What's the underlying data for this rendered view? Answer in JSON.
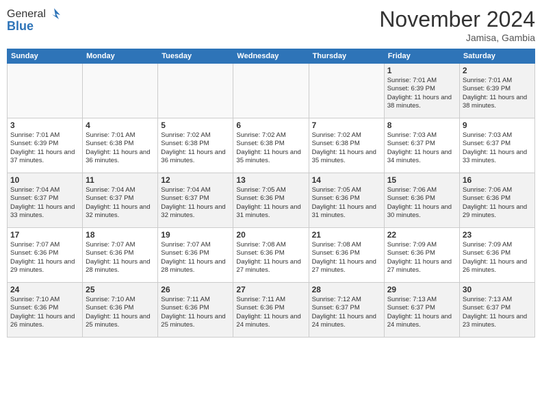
{
  "logo": {
    "general": "General",
    "blue": "Blue"
  },
  "header": {
    "month": "November 2024",
    "location": "Jamisa, Gambia"
  },
  "weekdays": [
    "Sunday",
    "Monday",
    "Tuesday",
    "Wednesday",
    "Thursday",
    "Friday",
    "Saturday"
  ],
  "weeks": [
    [
      {
        "day": "",
        "info": ""
      },
      {
        "day": "",
        "info": ""
      },
      {
        "day": "",
        "info": ""
      },
      {
        "day": "",
        "info": ""
      },
      {
        "day": "",
        "info": ""
      },
      {
        "day": "1",
        "info": "Sunrise: 7:01 AM\nSunset: 6:39 PM\nDaylight: 11 hours and 38 minutes."
      },
      {
        "day": "2",
        "info": "Sunrise: 7:01 AM\nSunset: 6:39 PM\nDaylight: 11 hours and 38 minutes."
      }
    ],
    [
      {
        "day": "3",
        "info": "Sunrise: 7:01 AM\nSunset: 6:39 PM\nDaylight: 11 hours and 37 minutes."
      },
      {
        "day": "4",
        "info": "Sunrise: 7:01 AM\nSunset: 6:38 PM\nDaylight: 11 hours and 36 minutes."
      },
      {
        "day": "5",
        "info": "Sunrise: 7:02 AM\nSunset: 6:38 PM\nDaylight: 11 hours and 36 minutes."
      },
      {
        "day": "6",
        "info": "Sunrise: 7:02 AM\nSunset: 6:38 PM\nDaylight: 11 hours and 35 minutes."
      },
      {
        "day": "7",
        "info": "Sunrise: 7:02 AM\nSunset: 6:38 PM\nDaylight: 11 hours and 35 minutes."
      },
      {
        "day": "8",
        "info": "Sunrise: 7:03 AM\nSunset: 6:37 PM\nDaylight: 11 hours and 34 minutes."
      },
      {
        "day": "9",
        "info": "Sunrise: 7:03 AM\nSunset: 6:37 PM\nDaylight: 11 hours and 33 minutes."
      }
    ],
    [
      {
        "day": "10",
        "info": "Sunrise: 7:04 AM\nSunset: 6:37 PM\nDaylight: 11 hours and 33 minutes."
      },
      {
        "day": "11",
        "info": "Sunrise: 7:04 AM\nSunset: 6:37 PM\nDaylight: 11 hours and 32 minutes."
      },
      {
        "day": "12",
        "info": "Sunrise: 7:04 AM\nSunset: 6:37 PM\nDaylight: 11 hours and 32 minutes."
      },
      {
        "day": "13",
        "info": "Sunrise: 7:05 AM\nSunset: 6:36 PM\nDaylight: 11 hours and 31 minutes."
      },
      {
        "day": "14",
        "info": "Sunrise: 7:05 AM\nSunset: 6:36 PM\nDaylight: 11 hours and 31 minutes."
      },
      {
        "day": "15",
        "info": "Sunrise: 7:06 AM\nSunset: 6:36 PM\nDaylight: 11 hours and 30 minutes."
      },
      {
        "day": "16",
        "info": "Sunrise: 7:06 AM\nSunset: 6:36 PM\nDaylight: 11 hours and 29 minutes."
      }
    ],
    [
      {
        "day": "17",
        "info": "Sunrise: 7:07 AM\nSunset: 6:36 PM\nDaylight: 11 hours and 29 minutes."
      },
      {
        "day": "18",
        "info": "Sunrise: 7:07 AM\nSunset: 6:36 PM\nDaylight: 11 hours and 28 minutes."
      },
      {
        "day": "19",
        "info": "Sunrise: 7:07 AM\nSunset: 6:36 PM\nDaylight: 11 hours and 28 minutes."
      },
      {
        "day": "20",
        "info": "Sunrise: 7:08 AM\nSunset: 6:36 PM\nDaylight: 11 hours and 27 minutes."
      },
      {
        "day": "21",
        "info": "Sunrise: 7:08 AM\nSunset: 6:36 PM\nDaylight: 11 hours and 27 minutes."
      },
      {
        "day": "22",
        "info": "Sunrise: 7:09 AM\nSunset: 6:36 PM\nDaylight: 11 hours and 27 minutes."
      },
      {
        "day": "23",
        "info": "Sunrise: 7:09 AM\nSunset: 6:36 PM\nDaylight: 11 hours and 26 minutes."
      }
    ],
    [
      {
        "day": "24",
        "info": "Sunrise: 7:10 AM\nSunset: 6:36 PM\nDaylight: 11 hours and 26 minutes."
      },
      {
        "day": "25",
        "info": "Sunrise: 7:10 AM\nSunset: 6:36 PM\nDaylight: 11 hours and 25 minutes."
      },
      {
        "day": "26",
        "info": "Sunrise: 7:11 AM\nSunset: 6:36 PM\nDaylight: 11 hours and 25 minutes."
      },
      {
        "day": "27",
        "info": "Sunrise: 7:11 AM\nSunset: 6:36 PM\nDaylight: 11 hours and 24 minutes."
      },
      {
        "day": "28",
        "info": "Sunrise: 7:12 AM\nSunset: 6:37 PM\nDaylight: 11 hours and 24 minutes."
      },
      {
        "day": "29",
        "info": "Sunrise: 7:13 AM\nSunset: 6:37 PM\nDaylight: 11 hours and 24 minutes."
      },
      {
        "day": "30",
        "info": "Sunrise: 7:13 AM\nSunset: 6:37 PM\nDaylight: 11 hours and 23 minutes."
      }
    ]
  ]
}
